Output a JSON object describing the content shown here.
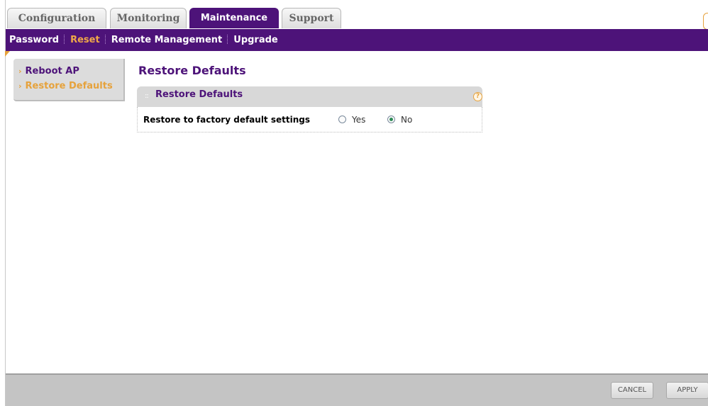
{
  "tabs": [
    {
      "label": "Configuration"
    },
    {
      "label": "Monitoring"
    },
    {
      "label": "Maintenance",
      "active": true
    },
    {
      "label": "Support"
    }
  ],
  "subnav": {
    "items": [
      {
        "label": "Password"
      },
      {
        "label": "Reset",
        "active": true
      },
      {
        "label": "Remote Management"
      },
      {
        "label": "Upgrade"
      }
    ]
  },
  "sidebar": {
    "items": [
      {
        "label": "Reboot AP"
      },
      {
        "label": "Restore Defaults",
        "active": true
      }
    ]
  },
  "main": {
    "title": "Restore Defaults",
    "panel": {
      "title": "Restore Defaults",
      "help_icon": "?",
      "row": {
        "label": "Restore to factory default settings",
        "options": [
          {
            "label": "Yes",
            "checked": false
          },
          {
            "label": "No",
            "checked": true
          }
        ]
      }
    }
  },
  "footer": {
    "cancel_label": "CANCEL",
    "apply_label": "APPLY"
  },
  "colors": {
    "brand_purple": "#4d1379",
    "accent_orange": "#e6a23c",
    "radio_checked": "#2e8b57"
  },
  "icons": {
    "help": "help-icon",
    "menu_arrow": "chevron-right-icon",
    "grip": "drag-grip-icon"
  }
}
